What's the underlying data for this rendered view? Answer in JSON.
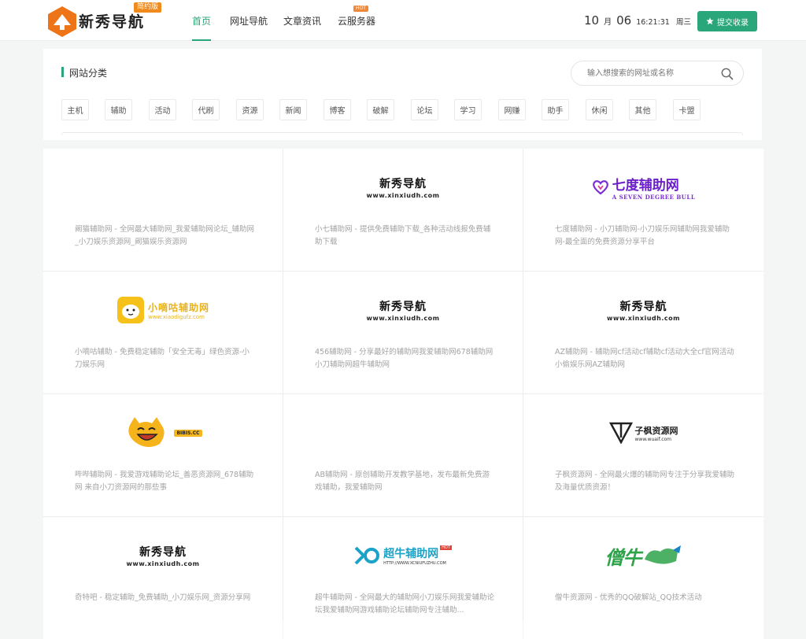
{
  "header": {
    "logo_text": "新秀导航",
    "logo_badge": "简约版",
    "nav": [
      {
        "label": "首页",
        "active": true
      },
      {
        "label": "网址导航",
        "active": false
      },
      {
        "label": "文章资讯",
        "active": false
      },
      {
        "label": "云服务器",
        "active": false,
        "badge": "HOT"
      }
    ],
    "date": {
      "month": "10",
      "month_unit": "月",
      "day": "06",
      "time": "16:21:31",
      "weekday": "周三"
    },
    "submit_label": "提交收录",
    "accent_color": "#2aa77a"
  },
  "categories": {
    "title": "网站分类",
    "search_placeholder": "输入想搜索的网址或名称",
    "tags": [
      "主机",
      "辅助",
      "活动",
      "代刷",
      "资源",
      "新闻",
      "博客",
      "破解",
      "论坛",
      "学习",
      "网赚",
      "助手",
      "休闲",
      "其他",
      "卡盟"
    ]
  },
  "sites": [
    {
      "logo": "none",
      "desc": "阚猫辅助网 - 全网最大辅助网_我爱辅助网论坛_辅助网_小刀娱乐资源网_阚猫娱乐资源网"
    },
    {
      "logo": "xinxiu",
      "logo_title": "新秀导航",
      "logo_sub": "www.xinxiudh.com",
      "desc": "小七辅助网 - 提供免费辅助下载_各种活动线报免费辅助下载"
    },
    {
      "logo": "qidu",
      "logo_title": "七度辅助网",
      "logo_sub": "A SEVEN DEGREE BULL",
      "desc": "七度辅助网 - 小刀辅助网-小刀娱乐网辅助网我爱辅助网-最全面的免费资源分享平台"
    },
    {
      "logo": "xiaodi",
      "logo_title": "小嘀咕辅助网",
      "logo_sub": "www.xiaodigufz.com",
      "desc": "小嘀咕辅助 - 免费稳定辅助「安全无毒」绿色资源-小刀娱乐网"
    },
    {
      "logo": "xinxiu",
      "logo_title": "新秀导航",
      "logo_sub": "www.xinxiudh.com",
      "desc": "456辅助网 - 分享最好的辅助网我爱辅助网678辅助网小刀辅助网超牛辅助网"
    },
    {
      "logo": "xinxiu",
      "logo_title": "新秀导航",
      "logo_sub": "www.xinxiudh.com",
      "desc": "AZ辅助网 - 辅助网cf活动cf辅助cf活动大全cf官网活动小偷娱乐网AZ辅助网"
    },
    {
      "logo": "bibis",
      "logo_sub": "BIBIS.CC",
      "desc": "哔哔辅助网 - 我爱游戏辅助论坛_善恶资源网_678辅助网 来自小刀资源网的那些事"
    },
    {
      "logo": "none",
      "desc": "AB辅助网 - 原创辅助开发教学基地，发布最新免费游戏辅助，我爱辅助网"
    },
    {
      "logo": "zifeng",
      "logo_title": "子枫资源网",
      "logo_sub": "www.wuaif.com",
      "desc": "子枫资源网 - 全网最火爆的辅助网专注于分享我爱辅助及海量优质资源！"
    },
    {
      "logo": "xinxiu",
      "logo_title": "新秀导航",
      "logo_sub": "www.xinxiudh.com",
      "desc": "奇特吧 - 稳定辅助_免费辅助_小刀娱乐网_资源分享网"
    },
    {
      "logo": "chaoniu",
      "logo_title": "超牛辅助网",
      "logo_badge": "HOT",
      "logo_sub": "HTTP://WWW.XCNIUFUZHU.COM",
      "desc": "超牛辅助网 - 全网最大的辅助网小刀娱乐网我爱辅助论坛我爱辅助网游戏辅助论坛辅助网专注辅助..."
    },
    {
      "logo": "sengniu",
      "logo_title": "僧牛",
      "desc": "僧牛资源网 - 优秀的QQ破解站_QQ技术活动"
    }
  ]
}
